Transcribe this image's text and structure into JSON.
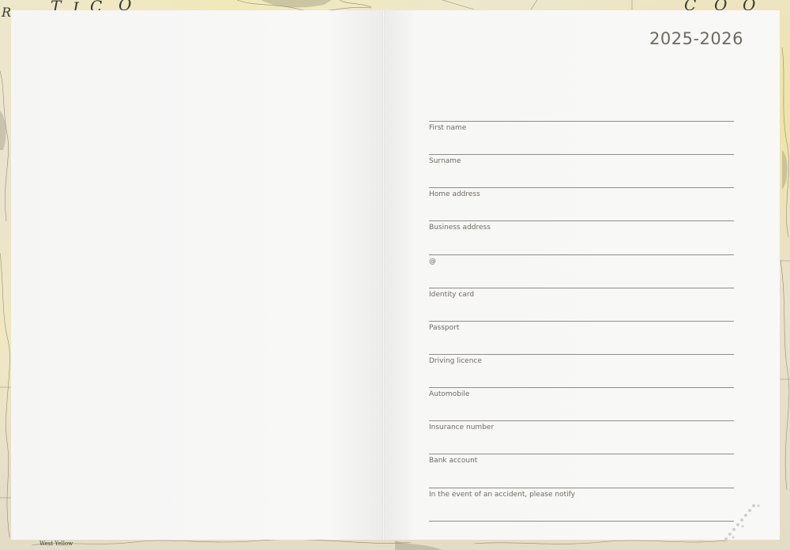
{
  "planner": {
    "year": "2025-2026",
    "fields": [
      {
        "label": "First name"
      },
      {
        "label": "Surname"
      },
      {
        "label": "Home address"
      },
      {
        "label": "Business address"
      },
      {
        "label": "@"
      },
      {
        "label": "Identity card"
      },
      {
        "label": "Passport"
      },
      {
        "label": "Driving licence"
      },
      {
        "label": "Automobile"
      },
      {
        "label": "Insurance number"
      },
      {
        "label": "Bank account"
      },
      {
        "label": "In the event of an accident, please notify"
      }
    ]
  },
  "map": {
    "top_letters": [
      "R",
      "T",
      "I",
      "C",
      "O",
      "C",
      "O",
      "O"
    ],
    "bottom_text": "West Yellow"
  },
  "colors": {
    "page": "#f7f7f6",
    "rule": "#8f8d88",
    "label": "#6f6b64",
    "map_base": "#e9e3cf"
  }
}
